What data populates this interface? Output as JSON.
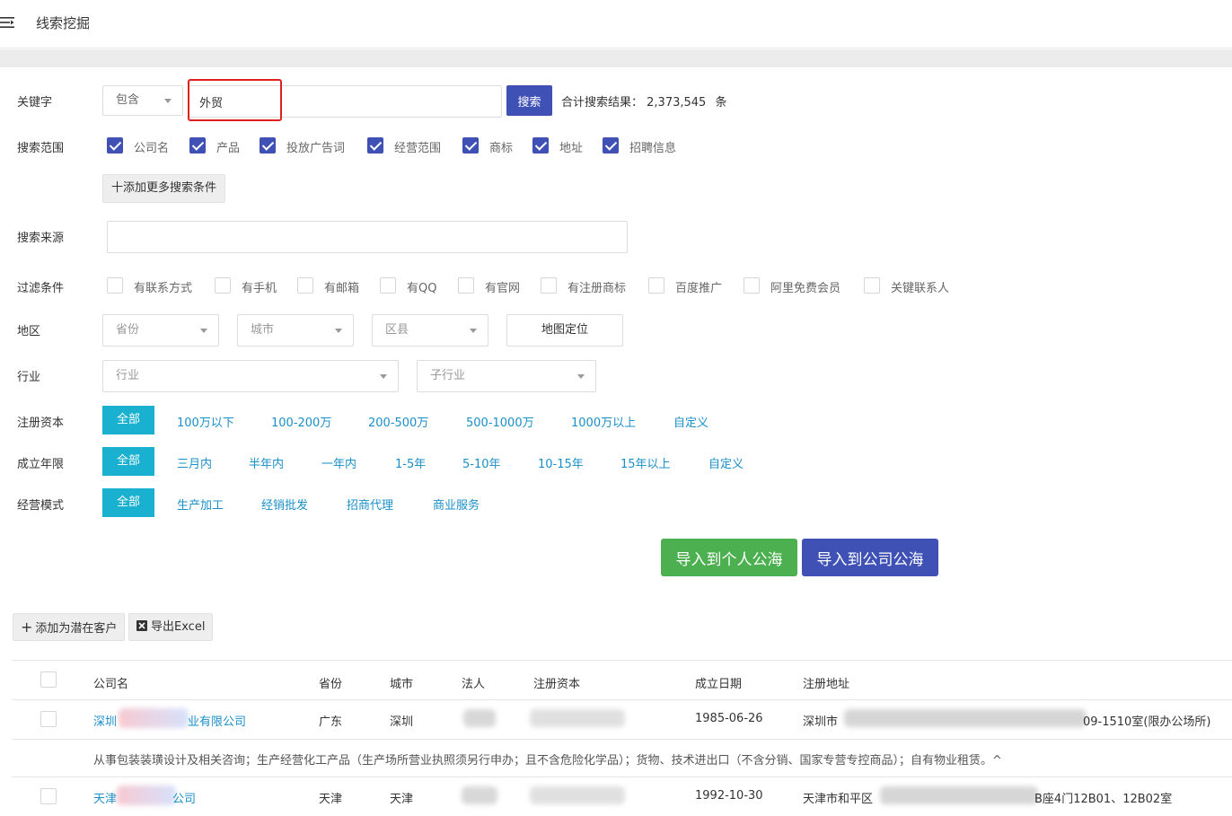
{
  "topbar": {
    "title": "线索挖掘",
    "menu_icon": "menu-collapse-icon"
  },
  "keyword": {
    "label": "关键字",
    "match_select": "包含",
    "input_value": "外贸",
    "search_button": "搜索",
    "result_prefix": "合计搜索结果：",
    "result_count": "2,373,545",
    "result_unit": "条"
  },
  "scope": {
    "label": "搜索范围",
    "options": [
      {
        "label": "公司名",
        "checked": true
      },
      {
        "label": "产品",
        "checked": true
      },
      {
        "label": "投放广告词",
        "checked": true
      },
      {
        "label": "经营范围",
        "checked": true
      },
      {
        "label": "商标",
        "checked": true
      },
      {
        "label": "地址",
        "checked": true
      },
      {
        "label": "招聘信息",
        "checked": true
      }
    ],
    "add_more": "十添加更多搜索条件"
  },
  "source": {
    "label": "搜索来源",
    "value": ""
  },
  "filters": {
    "label": "过滤条件",
    "options": [
      {
        "label": "有联系方式",
        "checked": false
      },
      {
        "label": "有手机",
        "checked": false
      },
      {
        "label": "有邮箱",
        "checked": false
      },
      {
        "label": "有QQ",
        "checked": false
      },
      {
        "label": "有官网",
        "checked": false
      },
      {
        "label": "有注册商标",
        "checked": false
      },
      {
        "label": "百度推广",
        "checked": false
      },
      {
        "label": "阿里免费会员",
        "checked": false
      },
      {
        "label": "关键联系人",
        "checked": false
      }
    ]
  },
  "region": {
    "label": "地区",
    "province": "省份",
    "city": "城市",
    "district": "区县",
    "map_button": "地图定位"
  },
  "industry": {
    "label": "行业",
    "industry": "行业",
    "sub_industry": "子行业"
  },
  "capital": {
    "label": "注册资本",
    "active": "全部",
    "options": [
      "100万以下",
      "100-200万",
      "200-500万",
      "500-1000万",
      "1000万以上",
      "自定义"
    ]
  },
  "age": {
    "label": "成立年限",
    "active": "全部",
    "options": [
      "三月内",
      "半年内",
      "一年内",
      "1-5年",
      "5-10年",
      "10-15年",
      "15年以上",
      "自定义"
    ]
  },
  "mode": {
    "label": "经营模式",
    "active": "全部",
    "options": [
      "生产加工",
      "经销批发",
      "招商代理",
      "商业服务"
    ]
  },
  "actions": {
    "import_personal": "导入到个人公海",
    "import_company": "导入到公司公海"
  },
  "toolbar": {
    "add_prospect": "添加为潜在客户",
    "export_excel": "导出Excel"
  },
  "table": {
    "headers": [
      "公司名",
      "省份",
      "城市",
      "法人",
      "注册资本",
      "成立日期",
      "注册地址"
    ],
    "rows": [
      {
        "company_start": "深圳",
        "company_end": "业有限公司",
        "province": "广东",
        "city": "深圳",
        "date": "1985-06-26",
        "address_start": "深圳市",
        "address_end": "09-1510室(限办公场所)",
        "description": "从事包装装璜设计及相关咨询；生产经营化工产品（生产场所营业执照须另行申办；且不含危险化学品）；货物、技术进出口（不含分销、国家专营专控商品）；自有物业租赁。^"
      },
      {
        "company_start": "天津",
        "company_end": "公司",
        "province": "天津",
        "city": "天津",
        "date": "1992-10-30",
        "address_start": "天津市和平区",
        "address_end": "B座4门12B01、12B02室"
      }
    ]
  }
}
